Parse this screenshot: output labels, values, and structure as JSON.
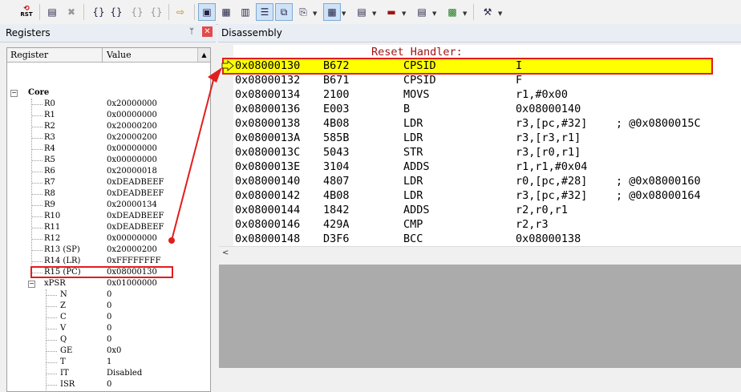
{
  "toolbar": {
    "reset_icon_text": "RST",
    "buttons": [
      {
        "name": "reset-icon",
        "glyph": "RST"
      },
      {
        "name": "insert-breakpoint-icon",
        "glyph": "▤"
      },
      {
        "name": "stop-icon",
        "glyph": "✖"
      },
      {
        "name": "step-into-icon",
        "glyph": "{}"
      },
      {
        "name": "step-over-icon",
        "glyph": "{}"
      },
      {
        "name": "step-out-icon",
        "glyph": "{}"
      },
      {
        "name": "run-to-cursor-icon",
        "glyph": "{}"
      },
      {
        "name": "show-next-statement-icon",
        "glyph": "⇨"
      },
      {
        "name": "command-window-icon",
        "glyph": "▣"
      },
      {
        "name": "disassembly-window-icon",
        "glyph": "▦"
      },
      {
        "name": "symbols-window-icon",
        "glyph": "▥"
      },
      {
        "name": "registers-window-icon",
        "glyph": "☰"
      },
      {
        "name": "call-stack-window-icon",
        "glyph": "⧉"
      },
      {
        "name": "watch-window-icon",
        "glyph": "⎘"
      },
      {
        "name": "memory-window-icon",
        "glyph": "▦"
      },
      {
        "name": "serial-window-icon",
        "glyph": "▤"
      },
      {
        "name": "analysis-window-icon",
        "glyph": "▬"
      },
      {
        "name": "trace-window-icon",
        "glyph": "▤"
      },
      {
        "name": "system-viewer-icon",
        "glyph": "▩"
      },
      {
        "name": "toolbox-icon",
        "glyph": "⚒"
      }
    ]
  },
  "registers": {
    "title": "Registers",
    "pin_glyph": "ᛘ",
    "close_glyph": "✕",
    "col_register": "Register",
    "col_value": "Value",
    "group_core": "Core",
    "rows": [
      {
        "name": "R0",
        "value": "0x20000000"
      },
      {
        "name": "R1",
        "value": "0x00000000"
      },
      {
        "name": "R2",
        "value": "0x20000200"
      },
      {
        "name": "R3",
        "value": "0x20000200"
      },
      {
        "name": "R4",
        "value": "0x00000000"
      },
      {
        "name": "R5",
        "value": "0x00000000"
      },
      {
        "name": "R6",
        "value": "0x20000018"
      },
      {
        "name": "R7",
        "value": "0xDEADBEEF"
      },
      {
        "name": "R8",
        "value": "0xDEADBEEF"
      },
      {
        "name": "R9",
        "value": "0x20000134"
      },
      {
        "name": "R10",
        "value": "0xDEADBEEF"
      },
      {
        "name": "R11",
        "value": "0xDEADBEEF"
      },
      {
        "name": "R12",
        "value": "0x00000000"
      },
      {
        "name": "R13 (SP)",
        "value": "0x20000200"
      },
      {
        "name": "R14 (LR)",
        "value": "0xFFFFFFFF"
      },
      {
        "name": "R15 (PC)",
        "value": "0x08000130"
      }
    ],
    "xpsr": {
      "name": "xPSR",
      "value": "0x01000000"
    },
    "flags": [
      {
        "name": "N",
        "value": "0"
      },
      {
        "name": "Z",
        "value": "0"
      },
      {
        "name": "C",
        "value": "0"
      },
      {
        "name": "V",
        "value": "0"
      },
      {
        "name": "Q",
        "value": "0"
      },
      {
        "name": "GE",
        "value": "0x0"
      },
      {
        "name": "T",
        "value": "1"
      },
      {
        "name": "IT",
        "value": "Disabled"
      },
      {
        "name": "ISR",
        "value": "0"
      }
    ]
  },
  "disassembly": {
    "title": "Disassembly",
    "section_label": "Reset Handler:",
    "lines": [
      {
        "addr": "0x08000130",
        "op": "B672",
        "mnem": "CPSID",
        "args": "I",
        "comment": ""
      },
      {
        "addr": "0x08000132",
        "op": "B671",
        "mnem": "CPSID",
        "args": "F",
        "comment": ""
      },
      {
        "addr": "0x08000134",
        "op": "2100",
        "mnem": "MOVS",
        "args": "r1,#0x00",
        "comment": ""
      },
      {
        "addr": "0x08000136",
        "op": "E003",
        "mnem": "B",
        "args": "0x08000140",
        "comment": ""
      },
      {
        "addr": "0x08000138",
        "op": "4B08",
        "mnem": "LDR",
        "args": "r3,[pc,#32]",
        "comment": "; @0x0800015C"
      },
      {
        "addr": "0x0800013A",
        "op": "585B",
        "mnem": "LDR",
        "args": "r3,[r3,r1]",
        "comment": ""
      },
      {
        "addr": "0x0800013C",
        "op": "5043",
        "mnem": "STR",
        "args": "r3,[r0,r1]",
        "comment": ""
      },
      {
        "addr": "0x0800013E",
        "op": "3104",
        "mnem": "ADDS",
        "args": "r1,r1,#0x04",
        "comment": ""
      },
      {
        "addr": "0x08000140",
        "op": "4807",
        "mnem": "LDR",
        "args": "r0,[pc,#28]",
        "comment": "; @0x08000160"
      },
      {
        "addr": "0x08000142",
        "op": "4B08",
        "mnem": "LDR",
        "args": "r3,[pc,#32]",
        "comment": "; @0x08000164"
      },
      {
        "addr": "0x08000144",
        "op": "1842",
        "mnem": "ADDS",
        "args": "r2,r0,r1",
        "comment": ""
      },
      {
        "addr": "0x08000146",
        "op": "429A",
        "mnem": "CMP",
        "args": "r2,r3",
        "comment": ""
      },
      {
        "addr": "0x08000148",
        "op": "D3F6",
        "mnem": "BCC",
        "args": "0x08000138",
        "comment": ""
      }
    ],
    "scroll_left_glyph": "<"
  },
  "colors": {
    "highlight": "#ffff00",
    "annotation_red": "#e21d1d",
    "label_red": "#a01414"
  }
}
